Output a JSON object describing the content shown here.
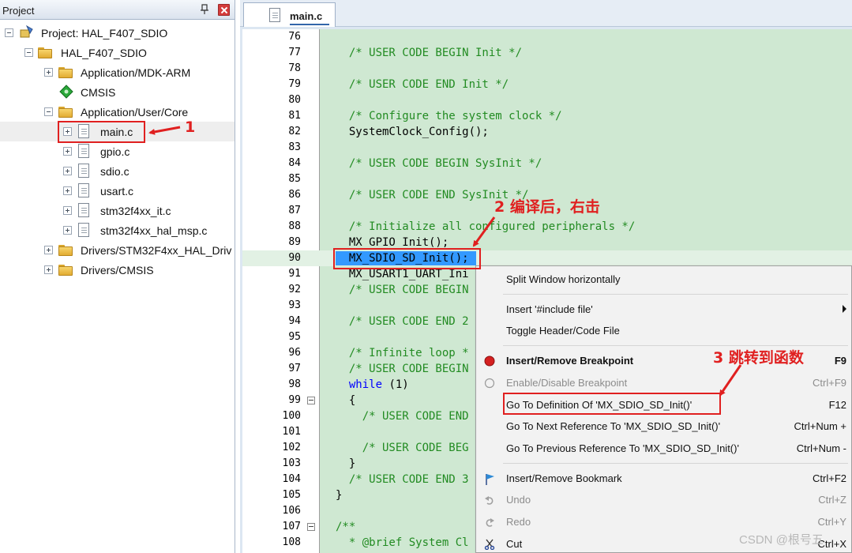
{
  "project_panel": {
    "title": "Project",
    "tree": [
      {
        "label": "Project: HAL_F407_SDIO",
        "icon": "project-icon",
        "expander": "minus"
      },
      {
        "label": "HAL_F407_SDIO",
        "icon": "target-folder-icon",
        "expander": "minus"
      },
      {
        "label": "Application/MDK-ARM",
        "icon": "folder-icon",
        "expander": "plus"
      },
      {
        "label": "CMSIS",
        "icon": "cmsis-gem-icon",
        "expander": "none"
      },
      {
        "label": "Application/User/Core",
        "icon": "folder-open-icon",
        "expander": "minus"
      },
      {
        "label": "main.c",
        "icon": "file-icon",
        "expander": "plus"
      },
      {
        "label": "gpio.c",
        "icon": "file-icon",
        "expander": "plus"
      },
      {
        "label": "sdio.c",
        "icon": "file-icon",
        "expander": "plus"
      },
      {
        "label": "usart.c",
        "icon": "file-icon",
        "expander": "plus"
      },
      {
        "label": "stm32f4xx_it.c",
        "icon": "file-icon",
        "expander": "plus"
      },
      {
        "label": "stm32f4xx_hal_msp.c",
        "icon": "file-icon",
        "expander": "plus"
      },
      {
        "label": "Drivers/STM32F4xx_HAL_Driv",
        "icon": "folder-icon",
        "expander": "plus"
      },
      {
        "label": "Drivers/CMSIS",
        "icon": "folder-icon",
        "expander": "plus"
      }
    ]
  },
  "editor": {
    "tab_label": "main.c",
    "lines": [
      {
        "num": "76",
        "text": "",
        "kind": "code"
      },
      {
        "num": "77",
        "text": "  /* USER CODE BEGIN Init */",
        "kind": "comment"
      },
      {
        "num": "78",
        "text": "",
        "kind": "code"
      },
      {
        "num": "79",
        "text": "  /* USER CODE END Init */",
        "kind": "comment"
      },
      {
        "num": "80",
        "text": "",
        "kind": "code"
      },
      {
        "num": "81",
        "text": "  /* Configure the system clock */",
        "kind": "comment"
      },
      {
        "num": "82",
        "text": "  SystemClock_Config();",
        "kind": "code"
      },
      {
        "num": "83",
        "text": "",
        "kind": "code"
      },
      {
        "num": "84",
        "text": "  /* USER CODE BEGIN SysInit */",
        "kind": "comment"
      },
      {
        "num": "85",
        "text": "",
        "kind": "code"
      },
      {
        "num": "86",
        "text": "  /* USER CODE END SysInit */",
        "kind": "comment"
      },
      {
        "num": "87",
        "text": "",
        "kind": "code"
      },
      {
        "num": "88",
        "text": "  /* Initialize all configured peripherals */",
        "kind": "comment"
      },
      {
        "num": "89",
        "text": "  MX_GPIO_Init();",
        "kind": "code"
      },
      {
        "num": "90",
        "text": "  MX_SDIO_SD_Init();",
        "kind": "code"
      },
      {
        "num": "91",
        "text": "  MX_USART1_UART_Ini",
        "kind": "code"
      },
      {
        "num": "92",
        "text": "  /* USER CODE BEGIN",
        "kind": "comment"
      },
      {
        "num": "93",
        "text": "",
        "kind": "code"
      },
      {
        "num": "94",
        "text": "  /* USER CODE END 2",
        "kind": "comment"
      },
      {
        "num": "95",
        "text": "",
        "kind": "code"
      },
      {
        "num": "96",
        "text": "  /* Infinite loop *",
        "kind": "comment"
      },
      {
        "num": "97",
        "text": "  /* USER CODE BEGIN",
        "kind": "comment"
      },
      {
        "num": "98",
        "text": "  while (1)",
        "kind": "while"
      },
      {
        "num": "99",
        "text": "  {",
        "kind": "code",
        "fold": true
      },
      {
        "num": "100",
        "text": "    /* USER CODE END",
        "kind": "comment"
      },
      {
        "num": "101",
        "text": "",
        "kind": "code"
      },
      {
        "num": "102",
        "text": "    /* USER CODE BEG",
        "kind": "comment"
      },
      {
        "num": "103",
        "text": "  }",
        "kind": "code"
      },
      {
        "num": "104",
        "text": "  /* USER CODE END 3",
        "kind": "comment"
      },
      {
        "num": "105",
        "text": "}",
        "kind": "code"
      },
      {
        "num": "106",
        "text": "",
        "kind": "code"
      },
      {
        "num": "107",
        "text": "/**",
        "kind": "comment",
        "fold": true
      },
      {
        "num": "108",
        "text": "  * @brief System Cl",
        "kind": "comment"
      }
    ]
  },
  "context_menu": {
    "items": [
      {
        "label": "Split Window horizontally",
        "shortcut": "",
        "icon": "",
        "state": "normal"
      },
      {
        "separator": true
      },
      {
        "label": "Insert '#include file'",
        "shortcut": "",
        "icon": "",
        "state": "normal",
        "submenu": true
      },
      {
        "label": "Toggle Header/Code File",
        "shortcut": "",
        "icon": "",
        "state": "normal"
      },
      {
        "separator": true
      },
      {
        "label": "Insert/Remove Breakpoint",
        "shortcut": "F9",
        "icon": "breakpoint-icon",
        "state": "bold"
      },
      {
        "label": "Enable/Disable Breakpoint",
        "shortcut": "Ctrl+F9",
        "icon": "breakpoint-outline-icon",
        "state": "disabled"
      },
      {
        "label": "Go To Definition Of 'MX_SDIO_SD_Init()'",
        "shortcut": "F12",
        "icon": "",
        "state": "normal"
      },
      {
        "label": "Go To Next Reference To 'MX_SDIO_SD_Init()'",
        "shortcut": "Ctrl+Num +",
        "icon": "",
        "state": "normal"
      },
      {
        "label": "Go To Previous Reference To 'MX_SDIO_SD_Init()'",
        "shortcut": "Ctrl+Num -",
        "icon": "",
        "state": "normal"
      },
      {
        "separator": true
      },
      {
        "label": "Insert/Remove Bookmark",
        "shortcut": "Ctrl+F2",
        "icon": "bookmark-flag-icon",
        "state": "normal"
      },
      {
        "label": "Undo",
        "shortcut": "Ctrl+Z",
        "icon": "undo-icon",
        "state": "disabled"
      },
      {
        "label": "Redo",
        "shortcut": "Ctrl+Y",
        "icon": "redo-icon",
        "state": "disabled"
      },
      {
        "label": "Cut",
        "shortcut": "Ctrl+X",
        "icon": "scissors-icon",
        "state": "normal"
      }
    ]
  },
  "annotations": {
    "step1": "1",
    "step2": "2 编译后，右击",
    "step3": "3 跳转到函数"
  },
  "watermark": "CSDN @根号五",
  "colors": {
    "annotation_red": "#e02020",
    "code_bg": "#cfe8d2",
    "comment_green": "#228b22",
    "keyword_blue": "#0000ff",
    "selection_blue": "#3399ff"
  }
}
